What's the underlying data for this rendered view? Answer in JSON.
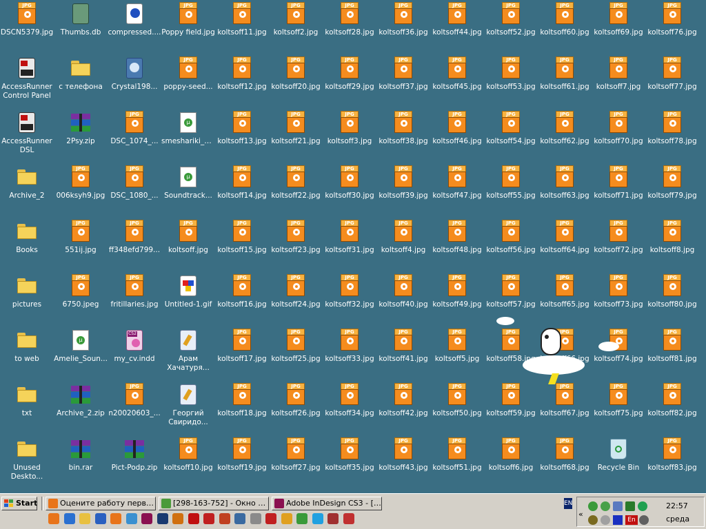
{
  "desktop": {
    "columns": [
      [
        {
          "label": "DSCN5379.jpg",
          "type": "jpg"
        },
        {
          "label": "AccessRunner Control Panel",
          "type": "app"
        },
        {
          "label": "AccessRunner DSL",
          "type": "app"
        },
        {
          "label": "Archive_2",
          "type": "folder"
        },
        {
          "label": "Books",
          "type": "folder"
        },
        {
          "label": "pictures",
          "type": "folder"
        },
        {
          "label": "to web",
          "type": "folder"
        },
        {
          "label": "txt",
          "type": "folder"
        },
        {
          "label": "Unused Deskto...",
          "type": "folder"
        }
      ],
      [
        {
          "label": "Thumbs.db",
          "type": "db"
        },
        {
          "label": "с телефона",
          "type": "folder"
        },
        {
          "label": "2Psy.zip",
          "type": "rar"
        },
        {
          "label": "006ksyh9.jpg",
          "type": "jpg"
        },
        {
          "label": "551ij.jpg",
          "type": "jpg"
        },
        {
          "label": "6750.jpeg",
          "type": "jpg"
        },
        {
          "label": "Amelie_Soun...",
          "type": "torrent"
        },
        {
          "label": "Archive_2.zip",
          "type": "rar"
        },
        {
          "label": "bin.rar",
          "type": "rar"
        }
      ],
      [
        {
          "label": "compressed....",
          "type": "media"
        },
        {
          "label": "Crystal198...",
          "type": "image"
        },
        {
          "label": "DSC_1074_...",
          "type": "jpg"
        },
        {
          "label": "DSC_1080_...",
          "type": "jpg"
        },
        {
          "label": "ff348efd799...",
          "type": "jpg"
        },
        {
          "label": "fritillaries.jpg",
          "type": "jpg"
        },
        {
          "label": "my_cv.indd",
          "type": "indd"
        },
        {
          "label": "n20020603_...",
          "type": "jpg"
        },
        {
          "label": "Pict-Podp.zip",
          "type": "rar"
        }
      ],
      [
        {
          "label": "Poppy field.jpg",
          "type": "jpg"
        },
        {
          "label": "poppy-seed...",
          "type": "jpg"
        },
        {
          "label": "smeshariki_d...",
          "type": "torrent"
        },
        {
          "label": "Soundtrack...",
          "type": "torrent"
        },
        {
          "label": "koltsoff.jpg",
          "type": "jpg"
        },
        {
          "label": "Untitled-1.gif",
          "type": "gif"
        },
        {
          "label": "Арам Хачатуря...",
          "type": "audio"
        },
        {
          "label": "Георгий Свиридо...",
          "type": "audio"
        },
        {
          "label": "koltsoff10.jpg",
          "type": "jpg"
        }
      ],
      [
        {
          "label": "koltsoff11.jpg",
          "type": "jpg"
        },
        {
          "label": "koltsoff12.jpg",
          "type": "jpg"
        },
        {
          "label": "koltsoff13.jpg",
          "type": "jpg"
        },
        {
          "label": "koltsoff14.jpg",
          "type": "jpg"
        },
        {
          "label": "koltsoff15.jpg",
          "type": "jpg"
        },
        {
          "label": "koltsoff16.jpg",
          "type": "jpg"
        },
        {
          "label": "koltsoff17.jpg",
          "type": "jpg"
        },
        {
          "label": "koltsoff18.jpg",
          "type": "jpg"
        },
        {
          "label": "koltsoff19.jpg",
          "type": "jpg"
        }
      ],
      [
        {
          "label": "koltsoff2.jpg",
          "type": "jpg"
        },
        {
          "label": "koltsoff20.jpg",
          "type": "jpg"
        },
        {
          "label": "koltsoff21.jpg",
          "type": "jpg"
        },
        {
          "label": "koltsoff22.jpg",
          "type": "jpg"
        },
        {
          "label": "koltsoff23.jpg",
          "type": "jpg"
        },
        {
          "label": "koltsoff24.jpg",
          "type": "jpg"
        },
        {
          "label": "koltsoff25.jpg",
          "type": "jpg"
        },
        {
          "label": "koltsoff26.jpg",
          "type": "jpg"
        },
        {
          "label": "koltsoff27.jpg",
          "type": "jpg"
        }
      ],
      [
        {
          "label": "koltsoff28.jpg",
          "type": "jpg"
        },
        {
          "label": "koltsoff29.jpg",
          "type": "jpg"
        },
        {
          "label": "koltsoff3.jpg",
          "type": "jpg"
        },
        {
          "label": "koltsoff30.jpg",
          "type": "jpg"
        },
        {
          "label": "koltsoff31.jpg",
          "type": "jpg"
        },
        {
          "label": "koltsoff32.jpg",
          "type": "jpg"
        },
        {
          "label": "koltsoff33.jpg",
          "type": "jpg"
        },
        {
          "label": "koltsoff34.jpg",
          "type": "jpg"
        },
        {
          "label": "koltsoff35.jpg",
          "type": "jpg"
        }
      ],
      [
        {
          "label": "koltsoff36.jpg",
          "type": "jpg"
        },
        {
          "label": "koltsoff37.jpg",
          "type": "jpg"
        },
        {
          "label": "koltsoff38.jpg",
          "type": "jpg"
        },
        {
          "label": "koltsoff39.jpg",
          "type": "jpg"
        },
        {
          "label": "koltsoff4.jpg",
          "type": "jpg"
        },
        {
          "label": "koltsoff40.jpg",
          "type": "jpg"
        },
        {
          "label": "koltsoff41.jpg",
          "type": "jpg"
        },
        {
          "label": "koltsoff42.jpg",
          "type": "jpg"
        },
        {
          "label": "koltsoff43.jpg",
          "type": "jpg"
        }
      ],
      [
        {
          "label": "koltsoff44.jpg",
          "type": "jpg"
        },
        {
          "label": "koltsoff45.jpg",
          "type": "jpg"
        },
        {
          "label": "koltsoff46.jpg",
          "type": "jpg"
        },
        {
          "label": "koltsoff47.jpg",
          "type": "jpg"
        },
        {
          "label": "koltsoff48.jpg",
          "type": "jpg"
        },
        {
          "label": "koltsoff49.jpg",
          "type": "jpg"
        },
        {
          "label": "koltsoff5.jpg",
          "type": "jpg"
        },
        {
          "label": "koltsoff50.jpg",
          "type": "jpg"
        },
        {
          "label": "koltsoff51.jpg",
          "type": "jpg"
        }
      ],
      [
        {
          "label": "koltsoff52.jpg",
          "type": "jpg"
        },
        {
          "label": "koltsoff53.jpg",
          "type": "jpg"
        },
        {
          "label": "koltsoff54.jpg",
          "type": "jpg"
        },
        {
          "label": "koltsoff55.jpg",
          "type": "jpg"
        },
        {
          "label": "koltsoff56.jpg",
          "type": "jpg"
        },
        {
          "label": "koltsoff57.jpg",
          "type": "jpg"
        },
        {
          "label": "koltsoff58.jpg",
          "type": "jpg"
        },
        {
          "label": "koltsoff59.jpg",
          "type": "jpg"
        },
        {
          "label": "koltsoff6.jpg",
          "type": "jpg"
        }
      ],
      [
        {
          "label": "koltsoff60.jpg",
          "type": "jpg"
        },
        {
          "label": "koltsoff61.jpg",
          "type": "jpg"
        },
        {
          "label": "koltsoff62.jpg",
          "type": "jpg"
        },
        {
          "label": "koltsoff63.jpg",
          "type": "jpg"
        },
        {
          "label": "koltsoff64.jpg",
          "type": "jpg"
        },
        {
          "label": "koltsoff65.jpg",
          "type": "jpg"
        },
        {
          "label": "koltsoff66.jpg",
          "type": "jpg"
        },
        {
          "label": "koltsoff67.jpg",
          "type": "jpg"
        },
        {
          "label": "koltsoff68.jpg",
          "type": "jpg"
        }
      ],
      [
        {
          "label": "koltsoff69.jpg",
          "type": "jpg"
        },
        {
          "label": "koltsoff7.jpg",
          "type": "jpg"
        },
        {
          "label": "koltsoff70.jpg",
          "type": "jpg"
        },
        {
          "label": "koltsoff71.jpg",
          "type": "jpg"
        },
        {
          "label": "koltsoff72.jpg",
          "type": "jpg"
        },
        {
          "label": "koltsoff73.jpg",
          "type": "jpg"
        },
        {
          "label": "koltsoff74.jpg",
          "type": "jpg"
        },
        {
          "label": "koltsoff75.jpg",
          "type": "jpg"
        },
        {
          "label": "Recycle Bin",
          "type": "recycle"
        }
      ],
      [
        {
          "label": "koltsoff76.jpg",
          "type": "jpg"
        },
        {
          "label": "koltsoff77.jpg",
          "type": "jpg"
        },
        {
          "label": "koltsoff78.jpg",
          "type": "jpg"
        },
        {
          "label": "koltsoff79.jpg",
          "type": "jpg"
        },
        {
          "label": "koltsoff8.jpg",
          "type": "jpg"
        },
        {
          "label": "koltsoff80.jpg",
          "type": "jpg"
        },
        {
          "label": "koltsoff81.jpg",
          "type": "jpg"
        },
        {
          "label": "koltsoff82.jpg",
          "type": "jpg"
        },
        {
          "label": "koltsoff83.jpg",
          "type": "jpg"
        }
      ]
    ],
    "jpg_tab": "JPG",
    "indd_tab": "CS2"
  },
  "taskbar": {
    "start_label": "Start",
    "buttons": [
      {
        "label": "Оцените работу перво...",
        "icon": "firefox-icon",
        "color": "#e8741a"
      },
      {
        "label": "[298-163-752] - Окно со...",
        "icon": "chat-window-icon",
        "color": "#4a9a3a"
      },
      {
        "label": "Adobe InDesign CS3 - [k...",
        "icon": "indesign-icon",
        "color": "#8a1050"
      }
    ],
    "quick_launch": [
      "firefox-icon",
      "ie-icon",
      "folder-icon",
      "media-player-icon",
      "firefox-icon",
      "globe-icon",
      "indesign-icon",
      "photoshop-icon",
      "illustrator-icon",
      "acrobat-icon",
      "flash-icon",
      "house-icon",
      "network-icon",
      "calculator-icon",
      "bug-icon",
      "pencil-icon",
      "torrent-icon",
      "skype-icon",
      "tools-icon",
      "font-icon"
    ],
    "lang_label": "EN",
    "tray_lang": "En",
    "clock": "22:57",
    "day": "среда"
  }
}
